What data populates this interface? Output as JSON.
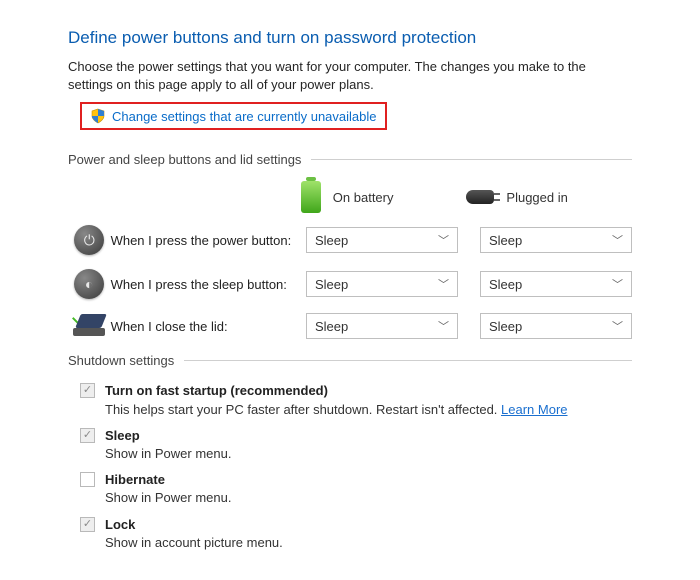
{
  "title": "Define power buttons and turn on password protection",
  "subtitle": "Choose the power settings that you want for your computer. The changes you make to the settings on this page apply to all of your power plans.",
  "change_link": "Change settings that are currently unavailable",
  "sections": {
    "buttons_header": "Power and sleep buttons and lid settings",
    "shutdown_header": "Shutdown settings"
  },
  "columns": {
    "battery": "On battery",
    "plugged": "Plugged in"
  },
  "rows": {
    "power": {
      "label": "When I press the power button:",
      "battery": "Sleep",
      "plugged": "Sleep"
    },
    "sleep": {
      "label": "When I press the sleep button:",
      "battery": "Sleep",
      "plugged": "Sleep"
    },
    "lid": {
      "label": "When I close the lid:",
      "battery": "Sleep",
      "plugged": "Sleep"
    }
  },
  "shutdown": {
    "fast": {
      "label": "Turn on fast startup (recommended)",
      "desc_pre": "This helps start your PC faster after shutdown. Restart isn't affected. ",
      "learn": "Learn More"
    },
    "sleep": {
      "label": "Sleep",
      "desc": "Show in Power menu."
    },
    "hibernate": {
      "label": "Hibernate",
      "desc": "Show in Power menu."
    },
    "lock": {
      "label": "Lock",
      "desc": "Show in account picture menu."
    }
  }
}
